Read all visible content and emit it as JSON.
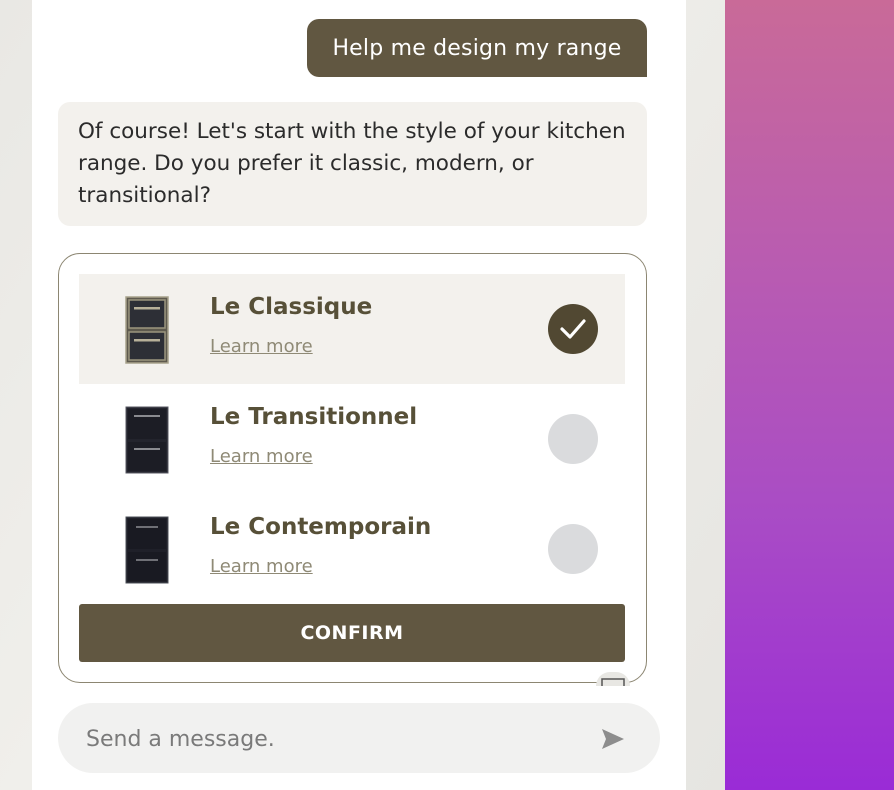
{
  "chat": {
    "user_message": "Help me design my range",
    "bot_message": "Of course! Let's start with the style of your kitchen range. Do you prefer it classic, modern, or transitional?"
  },
  "options": [
    {
      "title": "Le Classique",
      "link": "Learn more",
      "selected": true,
      "icon": "range-classic-image"
    },
    {
      "title": "Le Transitionnel",
      "link": "Learn more",
      "selected": false,
      "icon": "range-transitional-image"
    },
    {
      "title": "Le Contemporain",
      "link": "Learn more",
      "selected": false,
      "icon": "range-contemporary-image"
    }
  ],
  "confirm_label": "CONFIRM",
  "composer": {
    "placeholder": "Send a message.",
    "send_icon": "send-icon"
  },
  "colors": {
    "accent": "#615741",
    "selected_bg": "#f3f1ed",
    "radio_off": "#dadbdd",
    "title_text": "#575038"
  }
}
